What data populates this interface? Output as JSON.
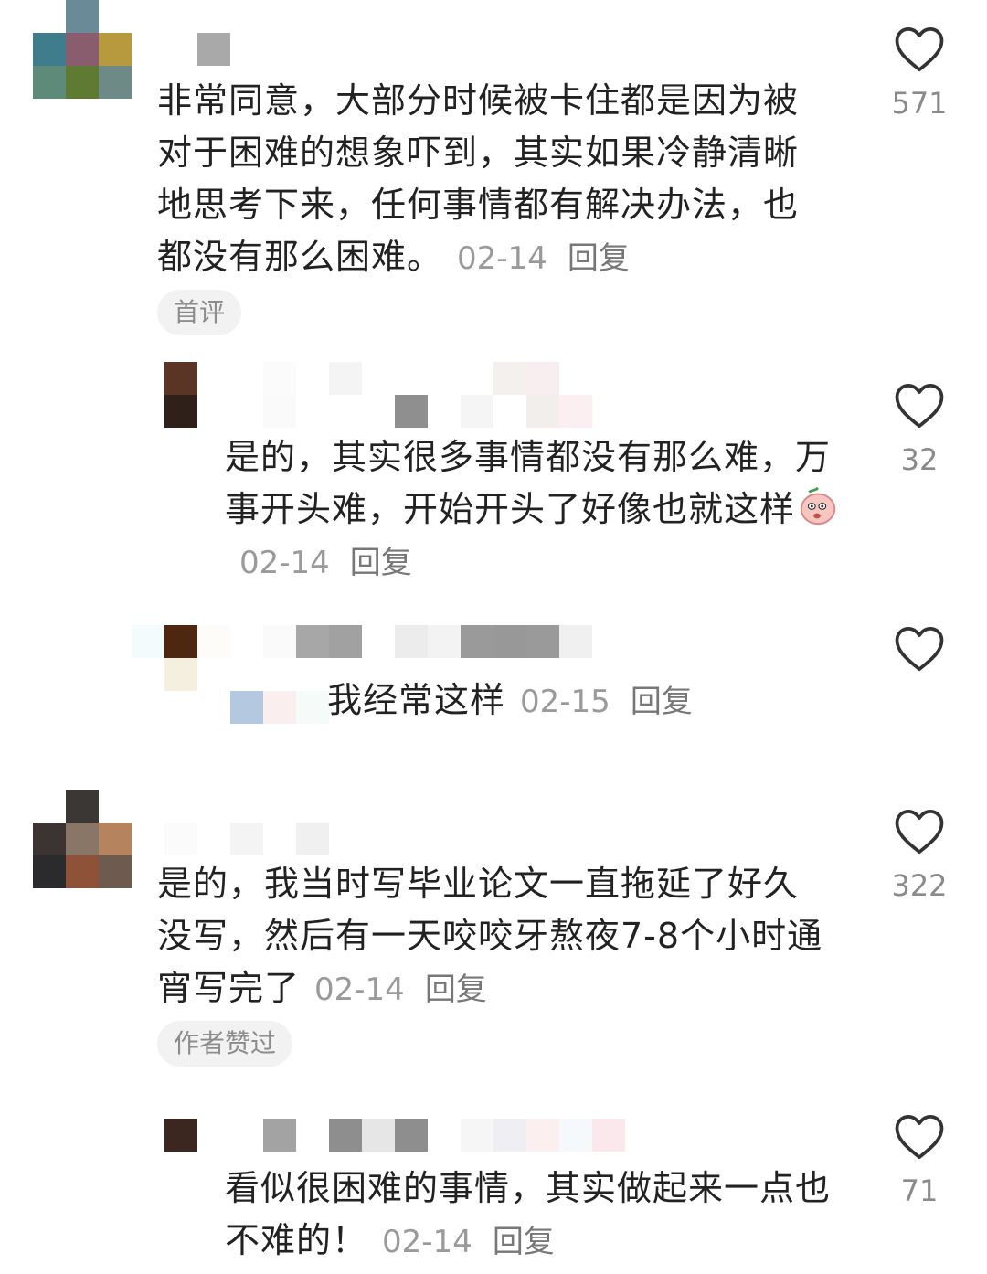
{
  "comments": [
    {
      "text": "非常同意，大部分时候被卡住都是因为被对于困难的想象吓到，其实如果冷静清晰地思考下来，任何事情都有解决办法，也都没有那么困难。",
      "date": "02-14",
      "reply": "回复",
      "tag": "首评",
      "likes": "571"
    },
    {
      "text": "是的，其实很多事情都没有那么难，万事开头难，开始开头了好像也就这样",
      "emoji": "peach-face-emoji",
      "date": "02-14",
      "reply": "回复",
      "likes": ""
    },
    {
      "text": "我经常这样",
      "date": "02-15",
      "reply": "回复",
      "likes": ""
    },
    {
      "text": "是的，我当时写毕业论文一直拖延了好久没写，然后有一天咬咬牙熬夜7-8个小时通宵写完了",
      "date": "02-14",
      "reply": "回复",
      "tag": "作者赞过",
      "likes": "322"
    },
    {
      "text": "看似很困难的事情，其实做起来一点也不难的！",
      "date": "02-14",
      "reply": "回复",
      "likes": "71"
    }
  ],
  "reply_likes": [
    "32"
  ],
  "colors": {
    "heart_stroke": "#333333",
    "meta": "#9a9a9a",
    "tag_bg": "#f2f2f2"
  }
}
